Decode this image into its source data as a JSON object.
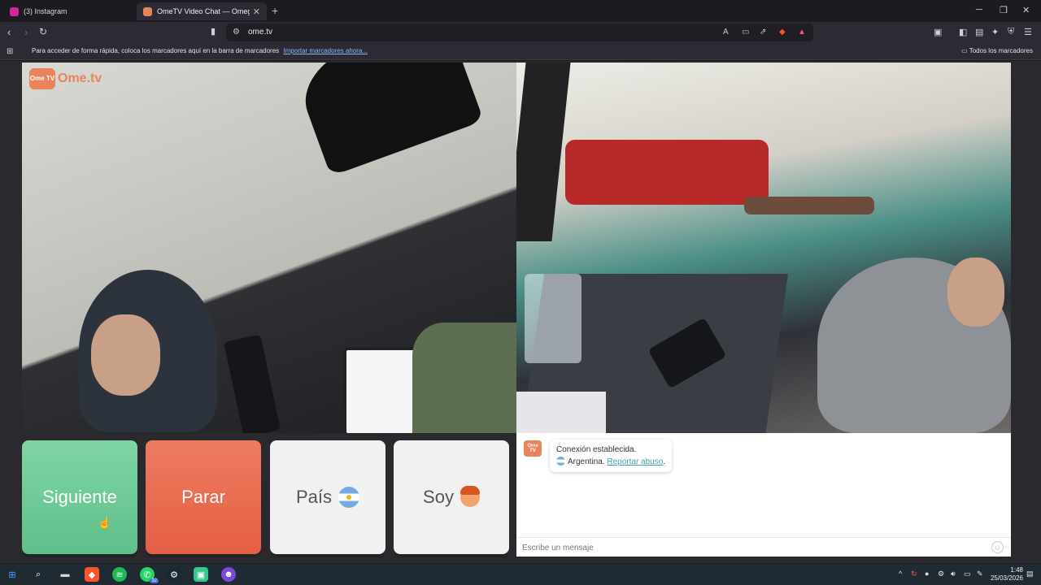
{
  "tabs": [
    {
      "label": "(3) Instagram",
      "active": false,
      "favicon_color": "#d6249f"
    },
    {
      "label": "OmeTV Video Chat — Omeg",
      "active": true,
      "favicon_color": "#e9835a"
    }
  ],
  "toolbar": {
    "url": "ome.tv",
    "new_tab": "+"
  },
  "bookmarks_bar": {
    "message": "Para acceder de forma rápida, coloca los marcadores aquí en la barra de marcadores",
    "import_link": "Importar marcadores ahora...",
    "all_bookmarks": "Todos los marcadores"
  },
  "site": {
    "logo_badge": "Ome TV",
    "logo_text": "Ome.tv"
  },
  "controls": {
    "next_label": "Siguiente",
    "stop_label": "Parar",
    "country_label": "País",
    "me_label": "Soy"
  },
  "chat": {
    "status": "Conexión establecida.",
    "country": "Argentina.",
    "report_link": "Reportar abuso",
    "report_suffix": ".",
    "input_placeholder": "Escribe un mensaje"
  },
  "taskbar": {
    "time": "1:48",
    "date": "25/03/2026",
    "whatsapp_badge": "32"
  },
  "colors": {
    "next": "#6cc896",
    "stop": "#e8684c",
    "brand": "#e9835a",
    "link": "#3fa2a8"
  }
}
